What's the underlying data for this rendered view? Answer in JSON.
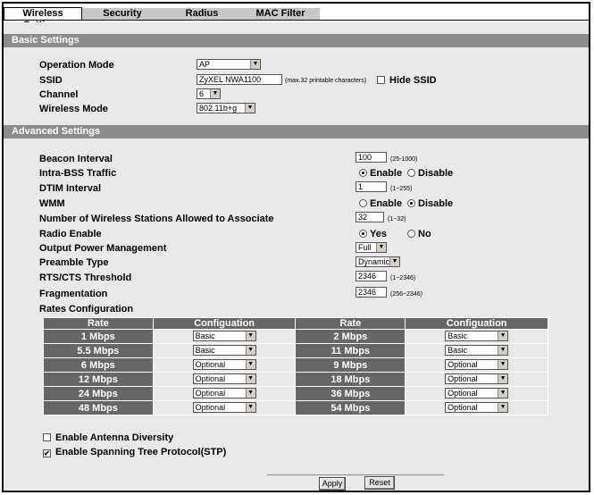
{
  "tabs": [
    {
      "label": "Wireless Settings",
      "active": true
    },
    {
      "label": "Security",
      "active": false
    },
    {
      "label": "Radius",
      "active": false
    },
    {
      "label": "MAC Filter",
      "active": false
    }
  ],
  "basic": {
    "header": "Basic Settings",
    "operation_mode": {
      "label": "Operation Mode",
      "value": "AP"
    },
    "ssid": {
      "label": "SSID",
      "value": "ZyXEL NWA1100",
      "hint": "(max.32 printable characters)",
      "hide_label": "Hide SSID",
      "hide_checked": false
    },
    "channel": {
      "label": "Channel",
      "value": "6"
    },
    "wireless_mode": {
      "label": "Wireless Mode",
      "value": "802.11b+g"
    }
  },
  "advanced": {
    "header": "Advanced Settings",
    "beacon": {
      "label": "Beacon Interval",
      "value": "100",
      "hint": "(25-1000)"
    },
    "intra_bss": {
      "label": "Intra-BSS Traffic",
      "enable": "Enable",
      "disable": "Disable",
      "selected": "enable"
    },
    "dtim": {
      "label": "DTIM Interval",
      "value": "1",
      "hint": "(1~255)"
    },
    "wmm": {
      "label": "WMM",
      "enable": "Enable",
      "disable": "Disable",
      "selected": "disable"
    },
    "stations": {
      "label": "Number of Wireless Stations Allowed to Associate",
      "value": "32",
      "hint": "(1~32)"
    },
    "radio": {
      "label": "Radio Enable",
      "yes": "Yes",
      "no": "No",
      "selected": "yes"
    },
    "power": {
      "label": "Output Power Management",
      "value": "Full"
    },
    "preamble": {
      "label": "Preamble Type",
      "value": "Dynamic"
    },
    "rts": {
      "label": "RTS/CTS Threshold",
      "value": "2346",
      "hint": "(1~2346)"
    },
    "frag": {
      "label": "Fragmentation",
      "value": "2346",
      "hint": "(256~2346)"
    },
    "rates_label": "Rates Configuration"
  },
  "rates": {
    "headers": [
      "Rate",
      "Configuation",
      "Rate",
      "Configuation"
    ],
    "rows": [
      {
        "r1": "1 Mbps",
        "c1": "Basic",
        "r2": "2 Mbps",
        "c2": "Basic"
      },
      {
        "r1": "5.5 Mbps",
        "c1": "Basic",
        "r2": "11 Mbps",
        "c2": "Basic"
      },
      {
        "r1": "6 Mbps",
        "c1": "Optional",
        "r2": "9 Mbps",
        "c2": "Optional"
      },
      {
        "r1": "12 Mbps",
        "c1": "Optional",
        "r2": "18 Mbps",
        "c2": "Optional"
      },
      {
        "r1": "24 Mbps",
        "c1": "Optional",
        "r2": "36 Mbps",
        "c2": "Optional"
      },
      {
        "r1": "48 Mbps",
        "c1": "Optional",
        "r2": "54 Mbps",
        "c2": "Optional"
      }
    ]
  },
  "options": {
    "antenna": {
      "label": "Enable Antenna Diversity",
      "checked": false
    },
    "stp": {
      "label": "Enable Spanning Tree Protocol(STP)",
      "checked": true
    }
  },
  "buttons": {
    "apply": "Apply",
    "reset": "Reset"
  }
}
